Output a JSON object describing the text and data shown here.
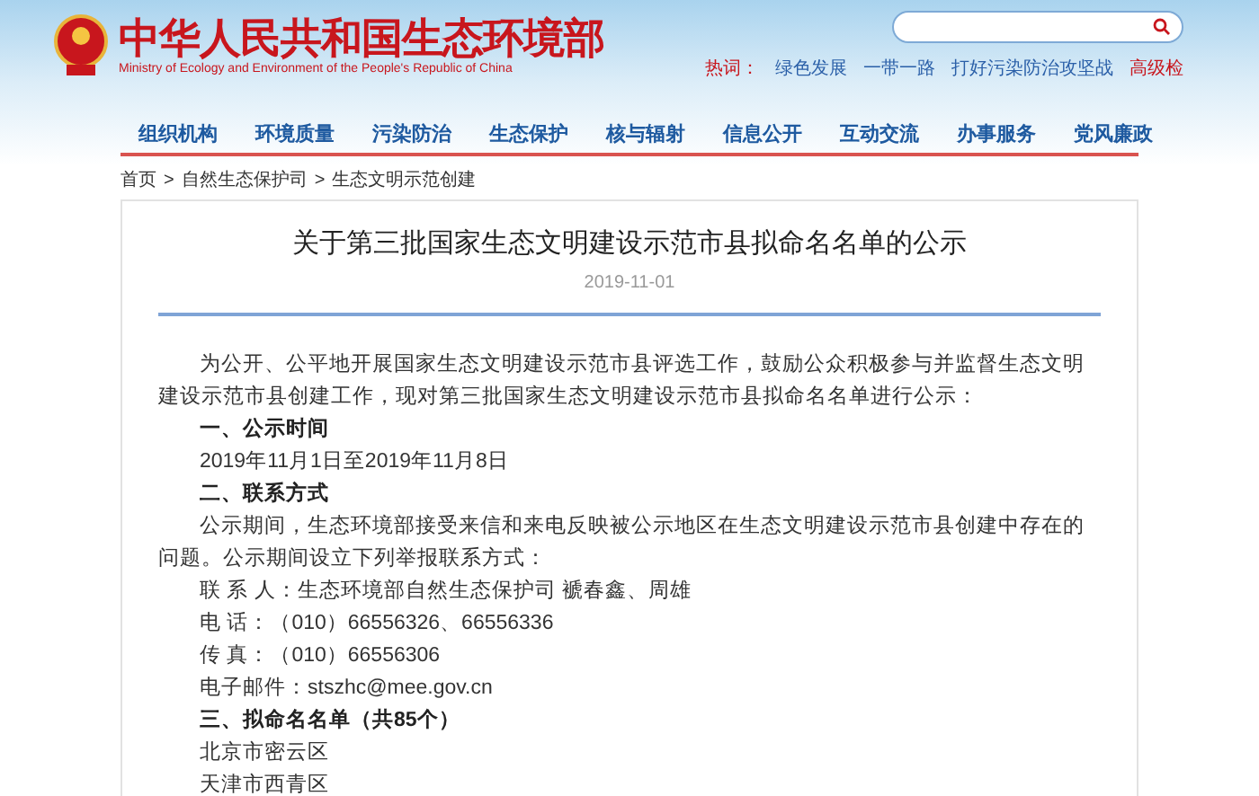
{
  "header": {
    "title": "中华人民共和国生态环境部",
    "subtitle": "Ministry of Ecology and Environment of the People's Republic of China",
    "hot_label": "热词：",
    "hot_words": [
      "绿色发展",
      "一带一路",
      "打好污染防治攻坚战"
    ],
    "advanced_search": "高级检"
  },
  "nav": [
    "组织机构",
    "环境质量",
    "污染防治",
    "生态保护",
    "核与辐射",
    "信息公开",
    "互动交流",
    "办事服务",
    "党风廉政"
  ],
  "breadcrumb": [
    "首页",
    "自然生态保护司",
    "生态文明示范创建"
  ],
  "breadcrumb_separator": ">",
  "article": {
    "title": "关于第三批国家生态文明建设示范市县拟命名名单的公示",
    "date": "2019-11-01",
    "paragraphs": [
      {
        "kind": "text",
        "text": "为公开、公平地开展国家生态文明建设示范市县评选工作，鼓励公众积极参与并监督生态文明建设示范市县创建工作，现对第三批国家生态文明建设示范市县拟命名名单进行公示："
      },
      {
        "kind": "heading",
        "text": "一、公示时间"
      },
      {
        "kind": "text",
        "text": "2019年11月1日至2019年11月8日"
      },
      {
        "kind": "heading",
        "text": "二、联系方式"
      },
      {
        "kind": "text",
        "text": "公示期间，生态环境部接受来信和来电反映被公示地区在生态文明建设示范市县创建中存在的问题。公示期间设立下列举报联系方式："
      },
      {
        "kind": "text",
        "text": "联 系 人：生态环境部自然生态保护司 褫春鑫、周雄"
      },
      {
        "kind": "text",
        "text": "电 话：（010）66556326、66556336"
      },
      {
        "kind": "text",
        "text": "传 真：（010）66556306"
      },
      {
        "kind": "text",
        "text": "电子邮件：stszhc@mee.gov.cn"
      },
      {
        "kind": "heading",
        "text": "三、拟命名名单（共85个）"
      },
      {
        "kind": "text",
        "text": "北京市密云区"
      },
      {
        "kind": "text",
        "text": "天津市西青区"
      }
    ]
  }
}
